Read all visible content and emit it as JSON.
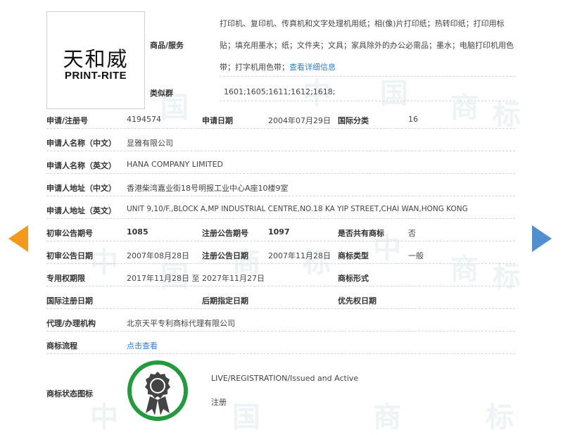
{
  "logo": {
    "cn_text": "天和威",
    "en_text": "PRINT-RITE"
  },
  "goods": {
    "label": "商品/服务",
    "text": "打印机、复印机、传真机和文字处理机用纸；相(像)片打印纸；热转印纸；打印用标贴；填充用墨水；纸；文件夹；文具；家具除外的办公必需品；墨水；电脑打印机用色带；打字机用色带；",
    "more_link": "查看详细信息"
  },
  "similar": {
    "label": "类似群",
    "value": "1601;1605;1611;1612;1618;"
  },
  "reg_no": {
    "label": "申请/注册号",
    "value": "4194574"
  },
  "app_date": {
    "label": "申请日期",
    "value": "2004年07月29日"
  },
  "intl_class": {
    "label": "国际分类",
    "value": "16"
  },
  "applicant_cn": {
    "label": "申请人名称（中文）",
    "value": "显雅有限公司"
  },
  "applicant_en": {
    "label": "申请人名称（英文）",
    "value": "HANA COMPANY LIMITED"
  },
  "address_cn": {
    "label": "申请人地址（中文）",
    "value": "香港柴湾嘉业街18号明报工业中心A座10楼9室"
  },
  "address_en": {
    "label": "申请人地址（英文）",
    "value": "UNIT 9,10/F.,BLOCK A,MP INDUSTRIAL CENTRE,NO.18 KA YIP STREET,CHAI WAN,HONG KONG"
  },
  "prelim_no": {
    "label": "初审公告期号",
    "value": "1085"
  },
  "reg_pub_no": {
    "label": "注册公告期号",
    "value": "1097"
  },
  "shared": {
    "label": "是否共有商标",
    "value": "否"
  },
  "prelim_date": {
    "label": "初审公告日期",
    "value": "2007年08月28日"
  },
  "reg_pub_date": {
    "label": "注册公告日期",
    "value": "2007年11月28日"
  },
  "tm_type": {
    "label": "商标类型",
    "value": "一般"
  },
  "exclusive": {
    "label": "专用权期限",
    "value": "2017年11月28日 至 2027年11月27日"
  },
  "tm_form": {
    "label": "商标形式",
    "value": ""
  },
  "intl_reg_date": {
    "label": "国际注册日期",
    "value": ""
  },
  "later_date": {
    "label": "后期指定日期",
    "value": ""
  },
  "priority_date": {
    "label": "优先权日期",
    "value": ""
  },
  "agent": {
    "label": "代理/办理机构",
    "value": "北京天平专利商标代理有限公司"
  },
  "flow": {
    "label": "商标流程",
    "link": "点击查看"
  },
  "status": {
    "label": "商标状态图标",
    "text_en": "LIVE/REGISTRATION/Issued and Active",
    "text_cn": "注册"
  },
  "watermark": [
    "中",
    "国",
    "商",
    "标"
  ],
  "colors": {
    "accent_link": "#2a7fd4",
    "nav_left": "#f39a1c",
    "nav_right": "#4f8fd0",
    "status_ring": "#239b3c"
  }
}
